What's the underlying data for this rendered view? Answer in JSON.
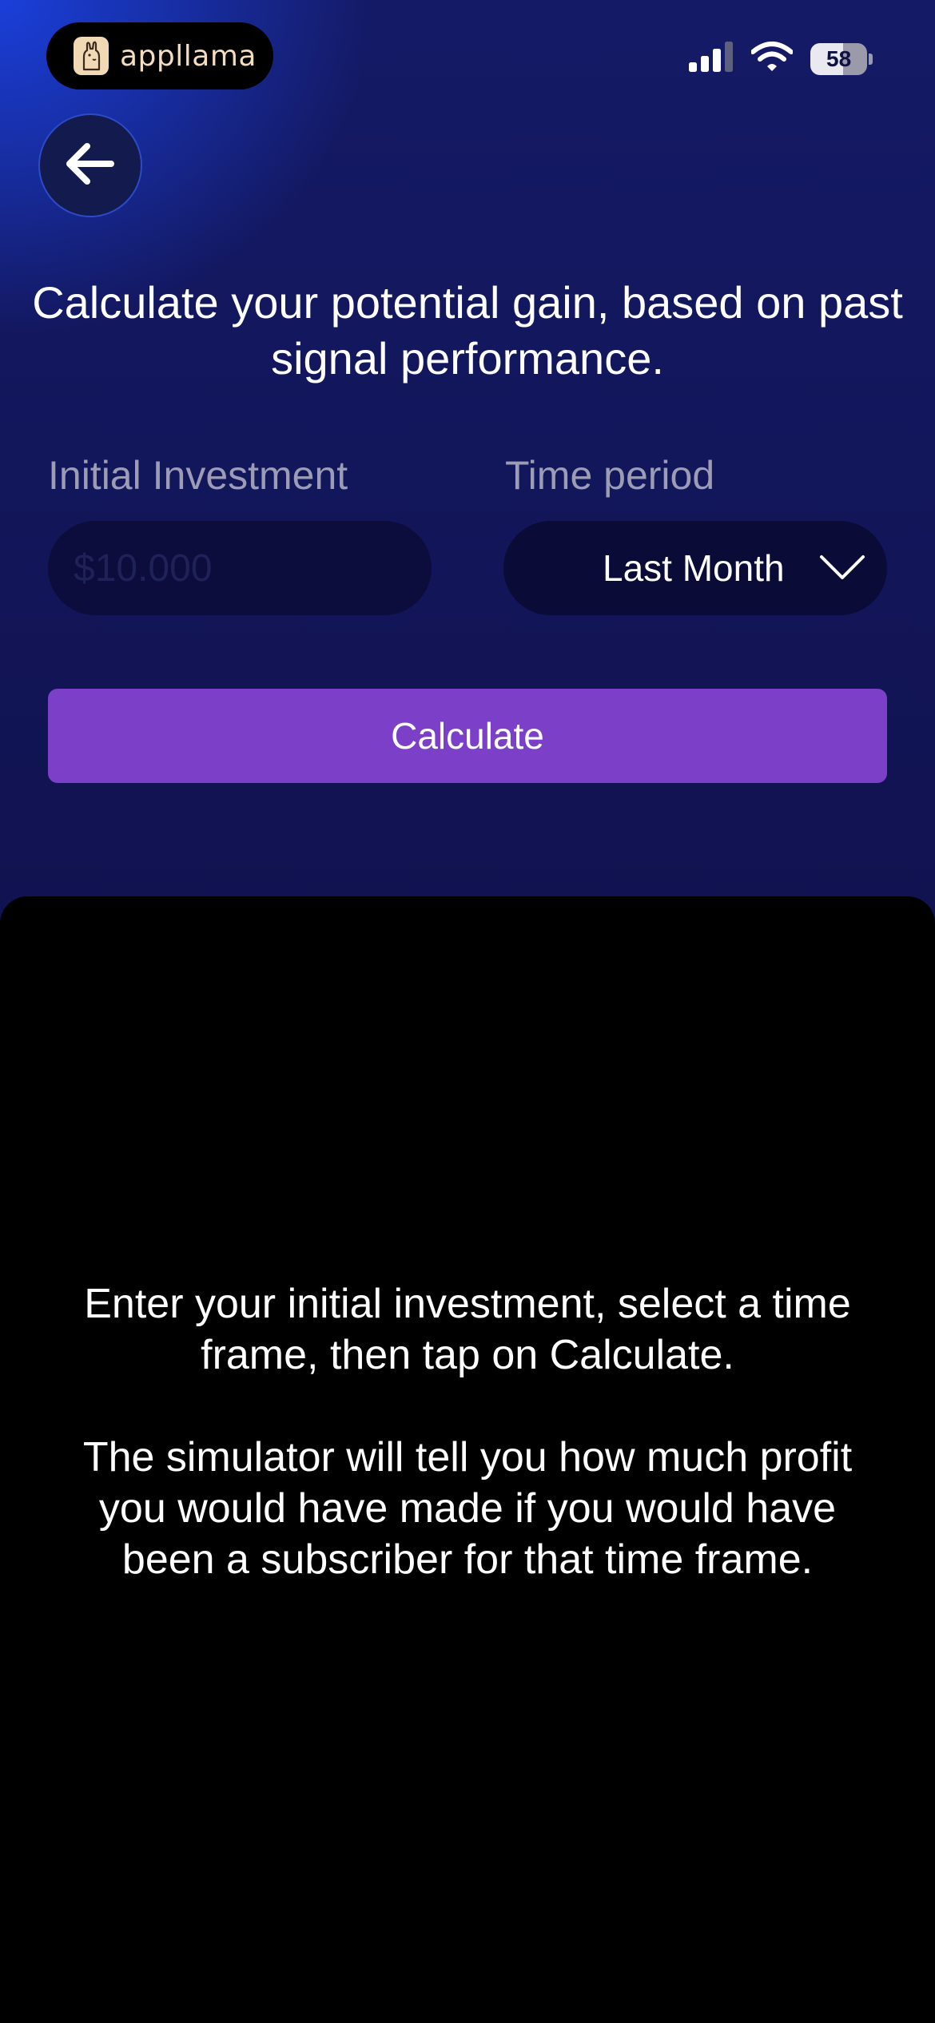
{
  "status_bar": {
    "app_name": "appllama",
    "app_icon": "llama-logo-icon",
    "battery": "58",
    "icons": [
      "cellular-signal-icon",
      "wifi-icon",
      "battery-icon"
    ]
  },
  "header": {
    "back_icon": "arrow-left-icon",
    "headline": "Calculate your potential gain, based on past signal performance."
  },
  "form": {
    "investment_label": "Initial Investment",
    "investment_placeholder": "$10.000",
    "investment_value": "",
    "period_label": "Time period",
    "period_selected": "Last Month",
    "period_icon": "chevron-down-icon"
  },
  "calculate_button": "Calculate",
  "results": {
    "instructions_1": "Enter your initial investment, select a time frame, then tap on Calculate.",
    "instructions_2": "The simulator will tell you how much profit you would have made if you would have been a subscriber for that time frame."
  },
  "colors": {
    "accent_button": "#7b3fc8",
    "background_gradient_top": "#1a3fd9",
    "background_dark": "#0f0f46",
    "panel": "#000000",
    "label_gray": "#9c9cb6"
  }
}
